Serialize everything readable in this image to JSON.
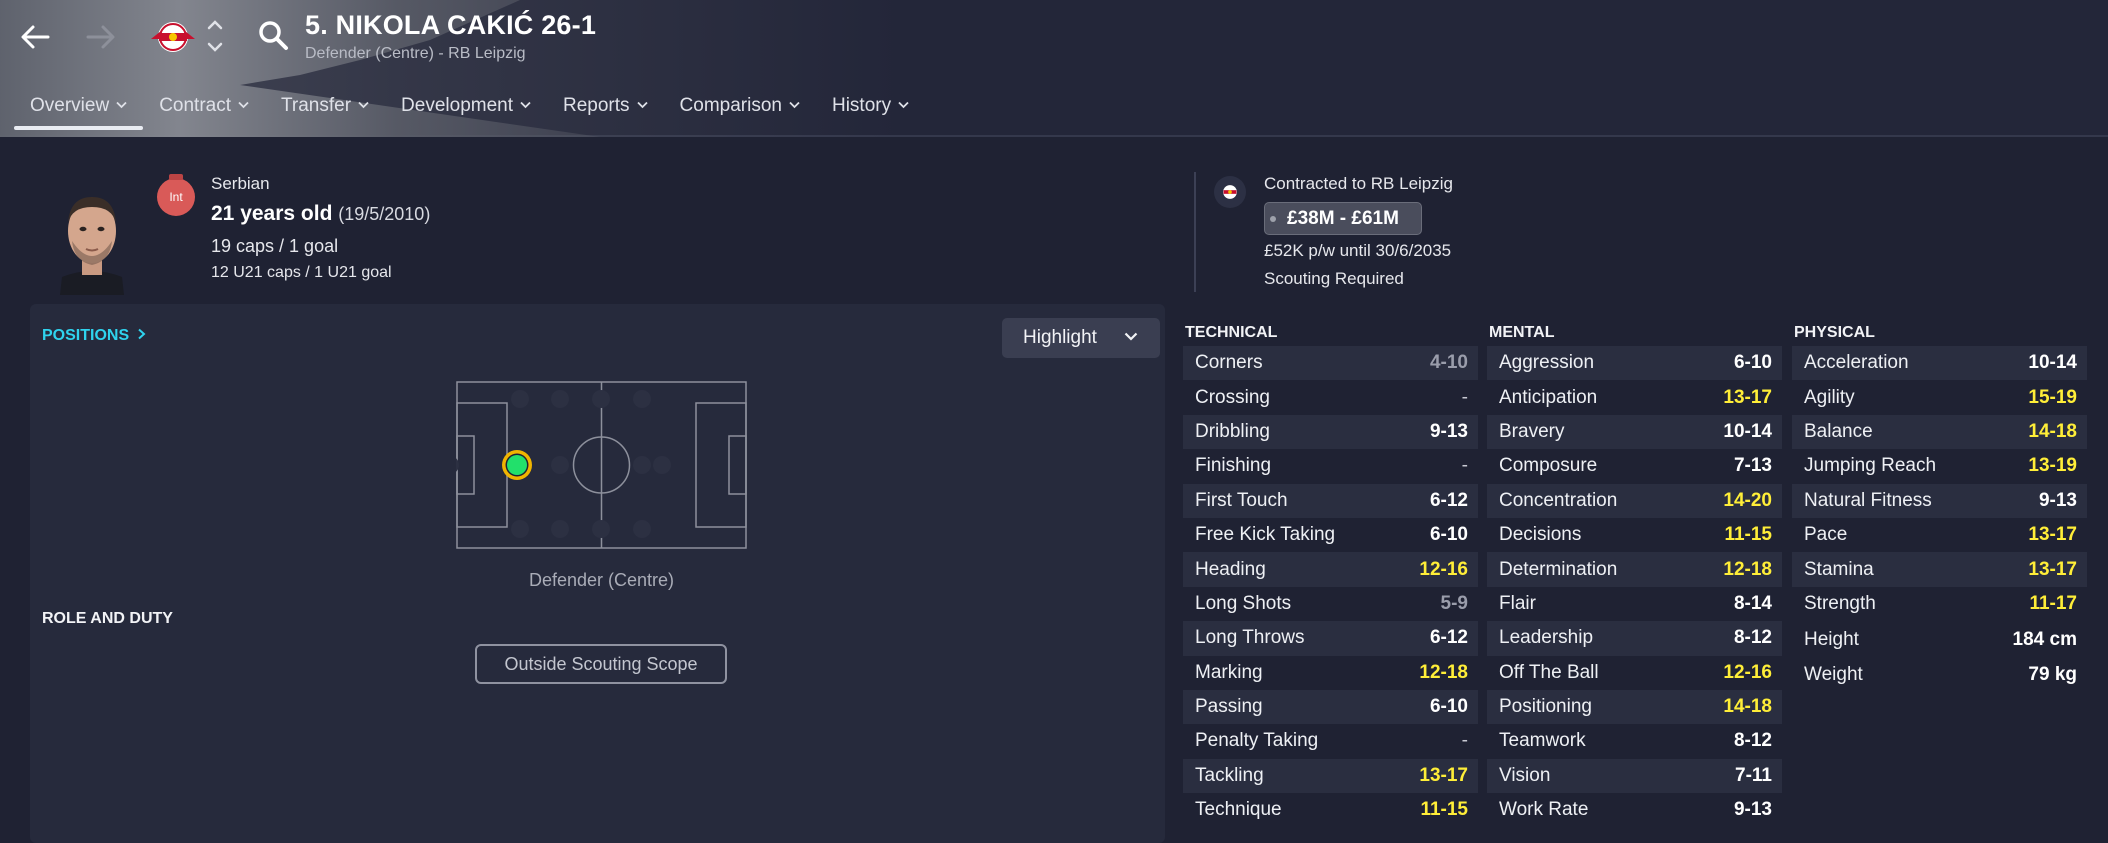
{
  "header": {
    "title": "5. NIKOLA CAKIĆ 26-1",
    "subtitle": "Defender (Centre) - RB Leipzig",
    "tabs": [
      {
        "label": "Overview",
        "active": true
      },
      {
        "label": "Contract"
      },
      {
        "label": "Transfer"
      },
      {
        "label": "Development"
      },
      {
        "label": "Reports"
      },
      {
        "label": "Comparison"
      },
      {
        "label": "History"
      }
    ]
  },
  "profile": {
    "int_badge": "Int",
    "nationality": "Serbian",
    "age": "21 years old",
    "dob": "(19/5/2010)",
    "caps": "19 caps / 1 goal",
    "u21_caps": "12 U21 caps / 1 U21 goal"
  },
  "contract": {
    "club_line": "Contracted to RB Leipzig",
    "value": "£38M - £61M",
    "wage_line": "£52K p/w until 30/6/2035",
    "scouting": "Scouting Required"
  },
  "positions": {
    "title": "POSITIONS",
    "highlight_label": "Highlight",
    "position_label": "Defender (Centre)",
    "role_title": "ROLE AND DUTY",
    "scope_button": "Outside Scouting Scope"
  },
  "attributes": {
    "technical": {
      "title": "TECHNICAL",
      "rows": [
        {
          "name": "Corners",
          "value": "4-10",
          "tone": "lo"
        },
        {
          "name": "Crossing",
          "value": "-",
          "tone": "dash"
        },
        {
          "name": "Dribbling",
          "value": "9-13",
          "tone": ""
        },
        {
          "name": "Finishing",
          "value": "-",
          "tone": "dash"
        },
        {
          "name": "First Touch",
          "value": "6-12",
          "tone": ""
        },
        {
          "name": "Free Kick Taking",
          "value": "6-10",
          "tone": ""
        },
        {
          "name": "Heading",
          "value": "12-16",
          "tone": "hi"
        },
        {
          "name": "Long Shots",
          "value": "5-9",
          "tone": "lo"
        },
        {
          "name": "Long Throws",
          "value": "6-12",
          "tone": ""
        },
        {
          "name": "Marking",
          "value": "12-18",
          "tone": "hi"
        },
        {
          "name": "Passing",
          "value": "6-10",
          "tone": ""
        },
        {
          "name": "Penalty Taking",
          "value": "-",
          "tone": "dash"
        },
        {
          "name": "Tackling",
          "value": "13-17",
          "tone": "hi"
        },
        {
          "name": "Technique",
          "value": "11-15",
          "tone": "hi"
        }
      ]
    },
    "mental": {
      "title": "MENTAL",
      "rows": [
        {
          "name": "Aggression",
          "value": "6-10",
          "tone": ""
        },
        {
          "name": "Anticipation",
          "value": "13-17",
          "tone": "hi"
        },
        {
          "name": "Bravery",
          "value": "10-14",
          "tone": ""
        },
        {
          "name": "Composure",
          "value": "7-13",
          "tone": ""
        },
        {
          "name": "Concentration",
          "value": "14-20",
          "tone": "hi"
        },
        {
          "name": "Decisions",
          "value": "11-15",
          "tone": "hi"
        },
        {
          "name": "Determination",
          "value": "12-18",
          "tone": "hi"
        },
        {
          "name": "Flair",
          "value": "8-14",
          "tone": ""
        },
        {
          "name": "Leadership",
          "value": "8-12",
          "tone": ""
        },
        {
          "name": "Off The Ball",
          "value": "12-16",
          "tone": "hi"
        },
        {
          "name": "Positioning",
          "value": "14-18",
          "tone": "hi"
        },
        {
          "name": "Teamwork",
          "value": "8-12",
          "tone": ""
        },
        {
          "name": "Vision",
          "value": "7-11",
          "tone": ""
        },
        {
          "name": "Work Rate",
          "value": "9-13",
          "tone": ""
        }
      ]
    },
    "physical": {
      "title": "PHYSICAL",
      "rows": [
        {
          "name": "Acceleration",
          "value": "10-14",
          "tone": ""
        },
        {
          "name": "Agility",
          "value": "15-19",
          "tone": "hi"
        },
        {
          "name": "Balance",
          "value": "14-18",
          "tone": "hi"
        },
        {
          "name": "Jumping Reach",
          "value": "13-19",
          "tone": "hi"
        },
        {
          "name": "Natural Fitness",
          "value": "9-13",
          "tone": ""
        },
        {
          "name": "Pace",
          "value": "13-17",
          "tone": "hi"
        },
        {
          "name": "Stamina",
          "value": "13-17",
          "tone": "hi"
        },
        {
          "name": "Strength",
          "value": "11-17",
          "tone": "hi"
        }
      ],
      "extras": [
        {
          "name": "Height",
          "value": "184 cm"
        },
        {
          "name": "Weight",
          "value": "79 kg"
        }
      ]
    }
  },
  "icons": {
    "back": "arrow-left-icon",
    "forward": "arrow-right-icon",
    "club": "rb-leipzig-badge-icon",
    "search": "search-icon"
  },
  "colors": {
    "accent_cyan": "#2fd3ee",
    "highlight_yellow": "#ffee38",
    "position_green": "#22e06b",
    "position_ring": "#f0b400"
  }
}
